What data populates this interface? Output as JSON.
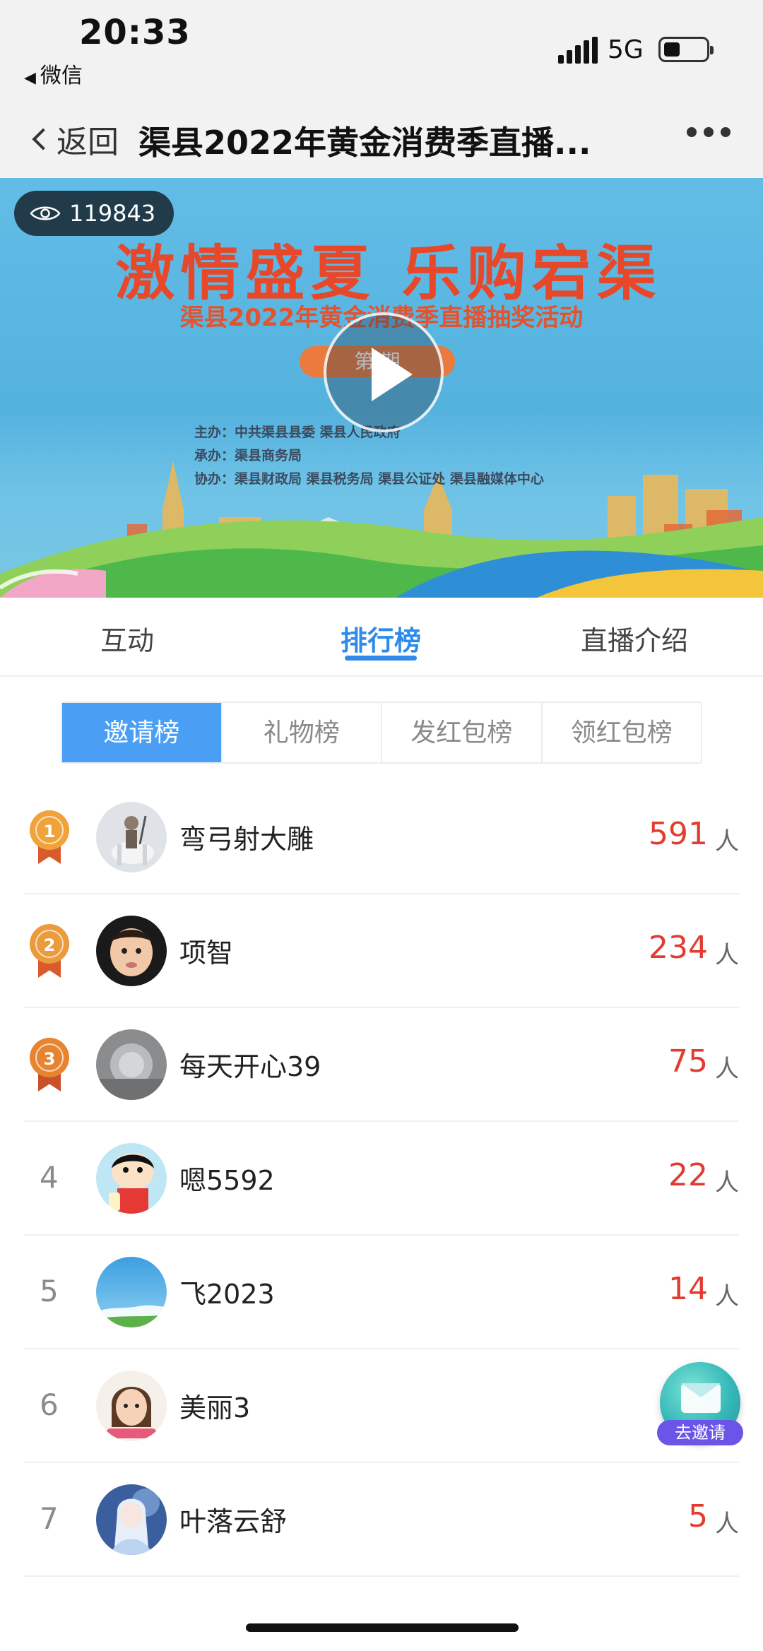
{
  "status_bar": {
    "time": "20:33",
    "back_app": "微信",
    "network": "5G"
  },
  "nav": {
    "back_label": "返回",
    "title": "渠县2022年黄金消费季直播..."
  },
  "banner": {
    "viewer_count": "119843",
    "headline": "激情盛夏  乐购宕渠",
    "subtitle": "渠县2022年黄金消费季直播抽奖活动",
    "issue": "第  期",
    "host_lines": [
      "主办：中共渠县县委   渠县人民政府",
      "承办：渠县商务局",
      "协办：渠县财政局  渠县税务局   渠县公证处  渠县融媒体中心"
    ]
  },
  "tabs": [
    {
      "label": "互动",
      "active": false
    },
    {
      "label": "排行榜",
      "active": true
    },
    {
      "label": "直播介绍",
      "active": false
    }
  ],
  "boards": [
    {
      "label": "邀请榜",
      "active": true
    },
    {
      "label": "礼物榜",
      "active": false
    },
    {
      "label": "发红包榜",
      "active": false
    },
    {
      "label": "领红包榜",
      "active": false
    }
  ],
  "ranking": [
    {
      "rank": "1",
      "name": "弯弓射大雕",
      "count": "591",
      "unit": "人",
      "medal_color": "#f0a33a",
      "avatar": "warrior-on-horse"
    },
    {
      "rank": "2",
      "name": "项智",
      "count": "234",
      "unit": "人",
      "medal_color": "#eb9a3c",
      "avatar": "baby-photo"
    },
    {
      "rank": "3",
      "name": "每天开心39",
      "count": "75",
      "unit": "人",
      "medal_color": "#e8842f",
      "avatar": "machine-photo"
    },
    {
      "rank": "4",
      "name": "嗯5592",
      "count": "22",
      "unit": "人",
      "avatar": "cartoon-boy"
    },
    {
      "rank": "5",
      "name": "飞2023",
      "count": "14",
      "unit": "人",
      "avatar": "blue-sky"
    },
    {
      "rank": "6",
      "name": "美丽3",
      "count": "",
      "unit": "",
      "avatar": "girl-photo"
    },
    {
      "rank": "7",
      "name": "叶落云舒",
      "count": "5",
      "unit": "人",
      "avatar": "anime-girl"
    }
  ],
  "invite_button": {
    "label": "去邀请"
  },
  "colors": {
    "accent": "#2f8bea",
    "board_active": "#4a9ff5",
    "count": "#e23b30",
    "banner_red": "#e8482a"
  }
}
